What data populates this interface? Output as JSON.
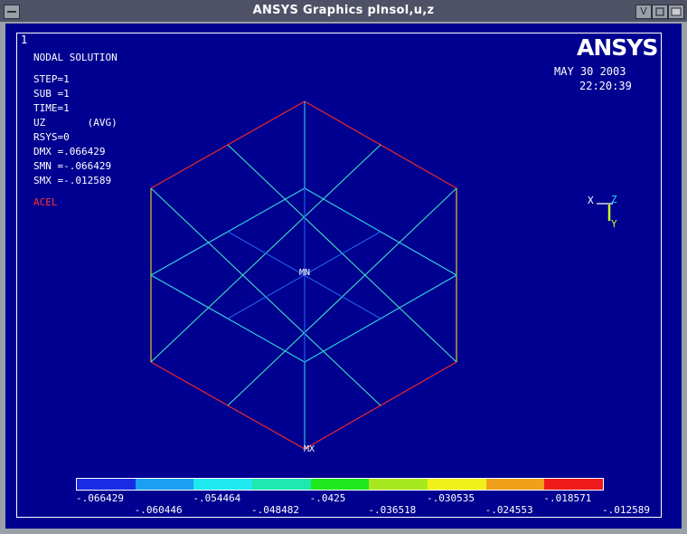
{
  "window": {
    "title": "ANSYS Graphics     plnsol,u,z"
  },
  "titlebar": {
    "minimize_glyph": "V",
    "maximize_glyph": "□",
    "menu_icon": "window-menu-icon"
  },
  "graphics": {
    "window_number": "1",
    "logo_text": "ANSYS",
    "header": "NODAL SOLUTION",
    "info_lines": [
      "STEP=1",
      "SUB =1",
      "TIME=1",
      "UZ       (AVG)",
      "RSYS=0",
      "DMX =.066429",
      "SMN =-.066429",
      "SMX =-.012589"
    ],
    "load_label": "ACEL",
    "date": "MAY 30 2003",
    "time": "22:20:39",
    "triad": {
      "x": "X",
      "y": "Y",
      "z": "Z"
    },
    "min_label": "MN",
    "max_label": "MX"
  },
  "legend": {
    "colors": [
      "#1a2be6",
      "#1aa0f0",
      "#1fe8f0",
      "#1fe8b0",
      "#1fe81f",
      "#a8e81f",
      "#f0f01a",
      "#f0a01a",
      "#f01a1a"
    ],
    "top_labels": [
      "-.066429",
      "-.054464",
      "-.0425",
      "-.030535",
      "-.018571"
    ],
    "bottom_labels": [
      "-.060446",
      "-.048482",
      "-.036518",
      "-.024553",
      "-.012589"
    ]
  },
  "colors": {
    "background": "#000190",
    "max_edge": "#f02020",
    "mid_edge": "#f0c020",
    "min_edge": "#1fe8f0"
  }
}
